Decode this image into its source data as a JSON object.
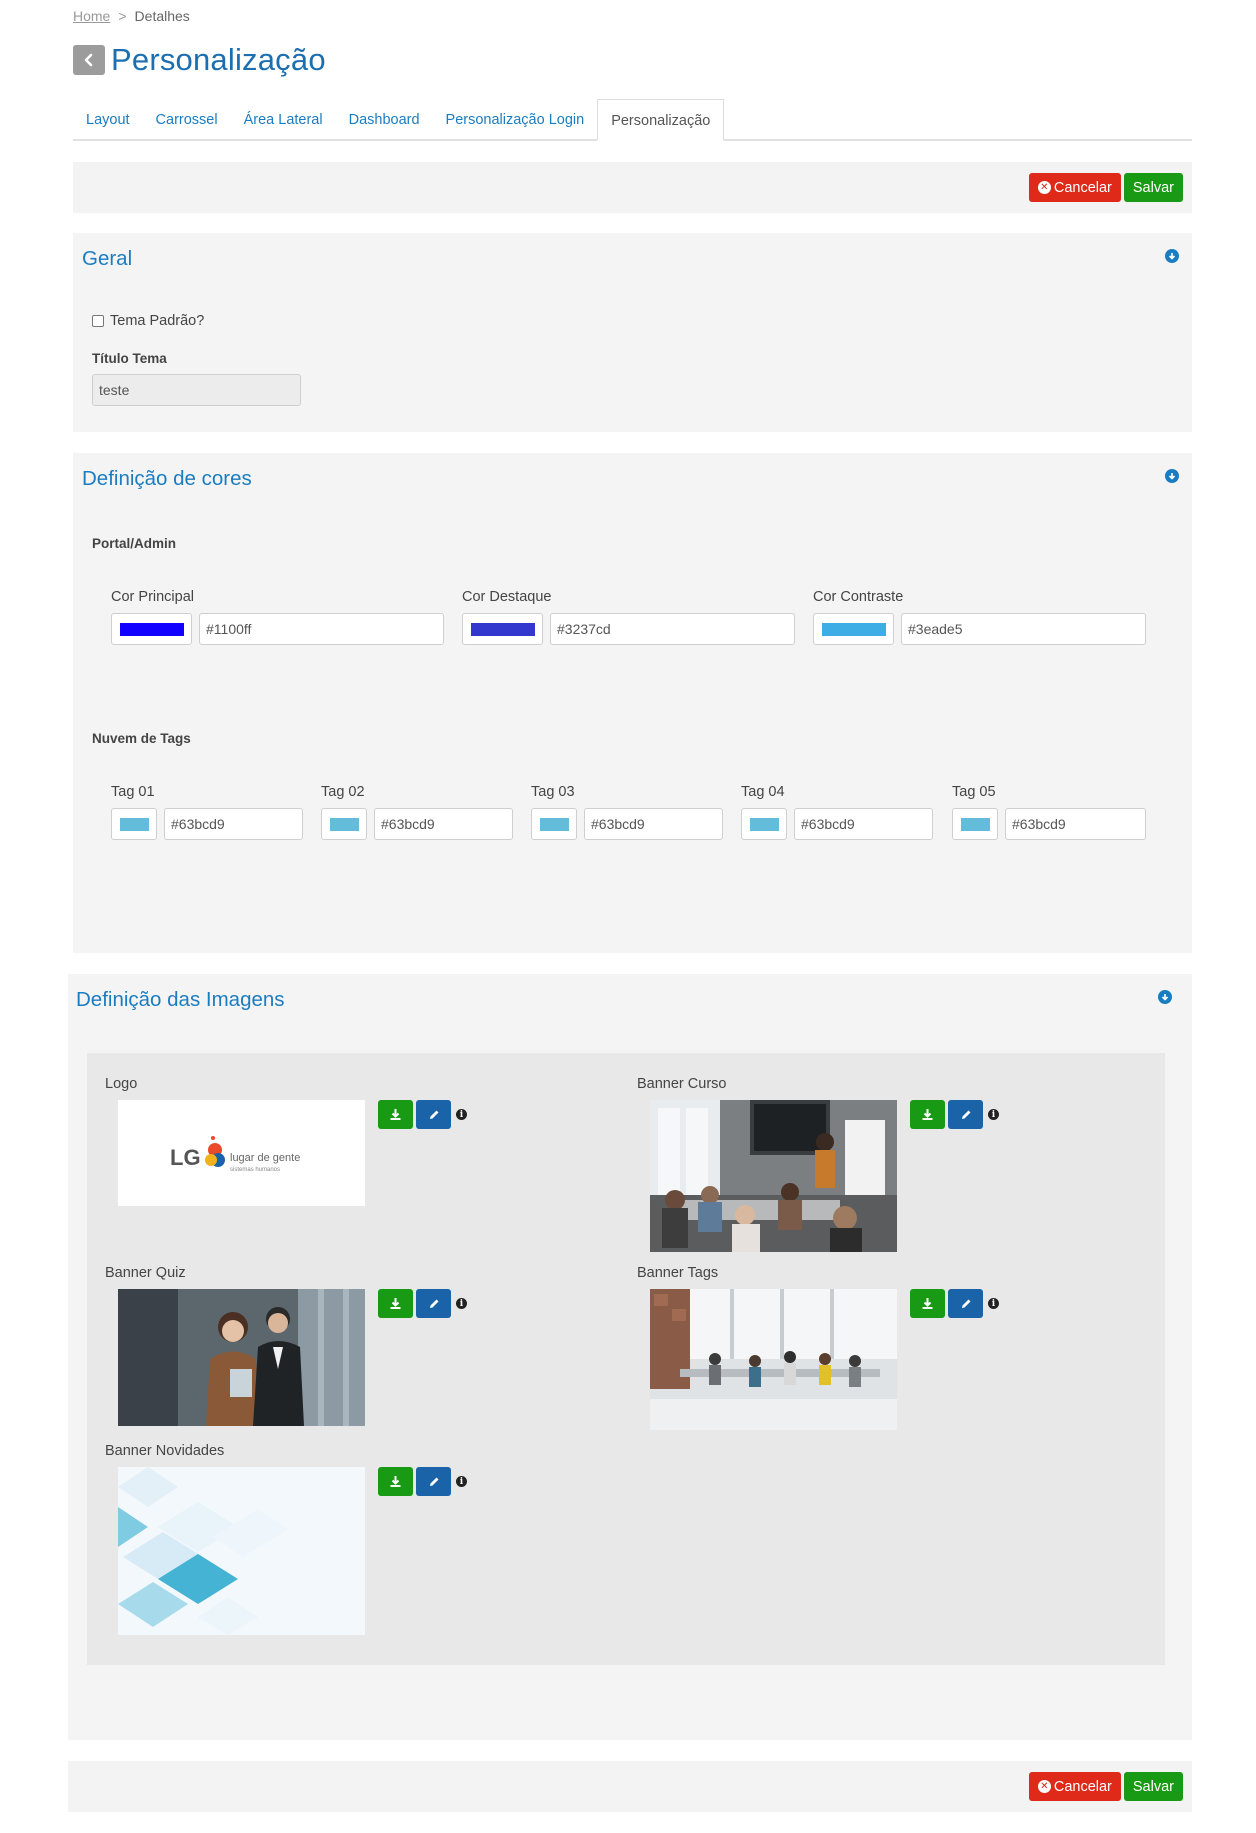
{
  "breadcrumb": {
    "home": "Home",
    "separator": ">",
    "current": "Detalhes"
  },
  "page": {
    "title": "Personalização"
  },
  "tabs": [
    {
      "label": "Layout"
    },
    {
      "label": "Carrossel"
    },
    {
      "label": "Área Lateral"
    },
    {
      "label": "Dashboard"
    },
    {
      "label": "Personalização Login"
    },
    {
      "label": "Personalização",
      "active": true
    }
  ],
  "actions": {
    "cancel": "Cancelar",
    "save": "Salvar"
  },
  "geral": {
    "title": "Geral",
    "default_theme_label": "Tema Padrão?",
    "default_theme_checked": false,
    "theme_title_label": "Título Tema",
    "theme_title_value": "teste"
  },
  "cores": {
    "title": "Definição de cores",
    "portal_admin_label": "Portal/Admin",
    "main_colors": [
      {
        "label": "Cor Principal",
        "value": "#1100ff",
        "color": "#1100ff"
      },
      {
        "label": "Cor Destaque",
        "value": "#3237cd",
        "color": "#3237cd"
      },
      {
        "label": "Cor Contraste",
        "value": "#3eade5",
        "color": "#3eade5"
      }
    ],
    "tag_cloud_label": "Nuvem de Tags",
    "tags": [
      {
        "label": "Tag 01",
        "value": "#63bcd9",
        "color": "#63bcd9"
      },
      {
        "label": "Tag 02",
        "value": "#63bcd9",
        "color": "#63bcd9"
      },
      {
        "label": "Tag 03",
        "value": "#63bcd9",
        "color": "#63bcd9"
      },
      {
        "label": "Tag 04",
        "value": "#63bcd9",
        "color": "#63bcd9"
      },
      {
        "label": "Tag 05",
        "value": "#63bcd9",
        "color": "#63bcd9"
      }
    ]
  },
  "imagens": {
    "title": "Definição das Imagens",
    "items": [
      {
        "label": "Logo",
        "logo_text": "LG",
        "logo_tagline": "lugar de gente",
        "logo_sub": "sistemas humanos"
      },
      {
        "label": "Banner Curso"
      },
      {
        "label": "Banner Quiz"
      },
      {
        "label": "Banner Tags"
      },
      {
        "label": "Banner Novidades"
      }
    ]
  },
  "colors": {
    "accent": "#1b7dc1",
    "cancel": "#df2a1a",
    "save": "#199a14",
    "edit": "#1b63a8"
  },
  "icons": [
    "back-arrow-icon",
    "close-circle-icon",
    "chevron-circle-icon",
    "download-icon",
    "pencil-icon",
    "info-icon"
  ]
}
